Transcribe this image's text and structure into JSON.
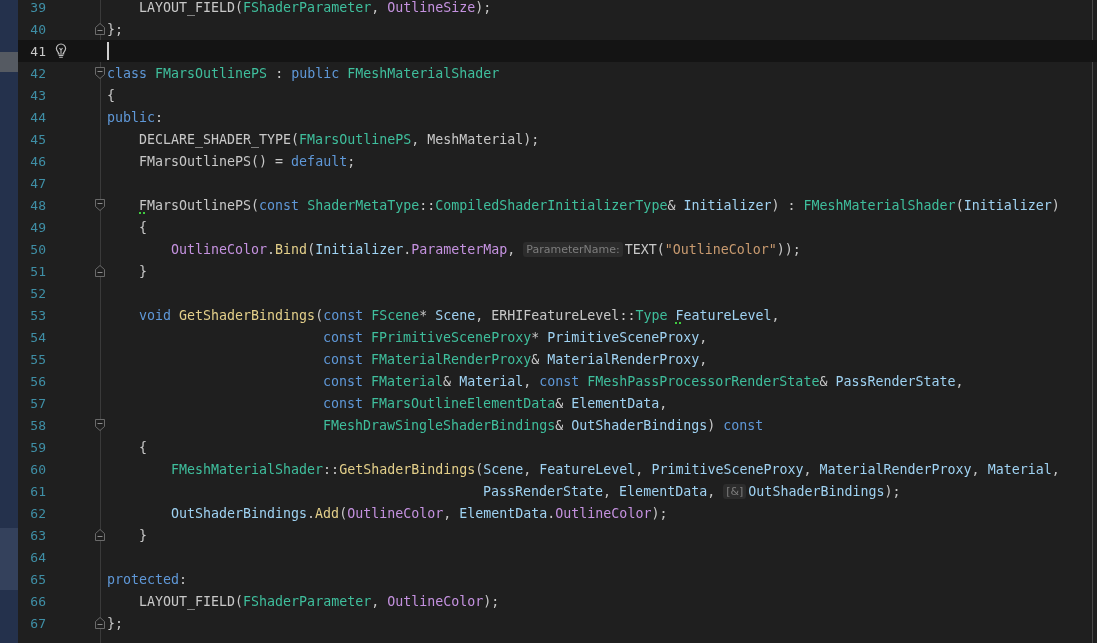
{
  "editor": {
    "lines": [
      {
        "number": "39",
        "current": false,
        "bulb": false,
        "fold_start": false,
        "fold_end": false,
        "tokens": [
          {
            "text": "    LAYOUT_FIELD(",
            "kind": "plain"
          },
          {
            "text": "FShaderParameter",
            "kind": "type"
          },
          {
            "text": ", ",
            "kind": "plain"
          },
          {
            "text": "OutlineSize",
            "kind": "field"
          },
          {
            "text": ");",
            "kind": "plain"
          }
        ]
      },
      {
        "number": "40",
        "current": false,
        "bulb": false,
        "fold_start": false,
        "fold_end": true,
        "tokens": [
          {
            "text": "};",
            "kind": "plain"
          }
        ]
      },
      {
        "number": "41",
        "current": true,
        "bulb": true,
        "fold_start": false,
        "fold_end": false
      },
      {
        "number": "42",
        "current": false,
        "bulb": false,
        "fold_start": true,
        "fold_end": false,
        "tokens": [
          {
            "text": "class ",
            "kind": "keyword"
          },
          {
            "text": "FMarsOutlinePS",
            "kind": "type"
          },
          {
            "text": " : ",
            "kind": "plain"
          },
          {
            "text": "public ",
            "kind": "keyword"
          },
          {
            "text": "FMeshMaterialShader",
            "kind": "type"
          }
        ]
      },
      {
        "number": "43",
        "current": false,
        "bulb": false,
        "fold_start": false,
        "fold_end": false,
        "tokens": [
          {
            "text": "{",
            "kind": "plain"
          }
        ]
      },
      {
        "number": "44",
        "current": false,
        "bulb": false,
        "fold_start": false,
        "fold_end": false,
        "tokens": [
          {
            "text": "public",
            "kind": "keyword"
          },
          {
            "text": ":",
            "kind": "plain"
          }
        ]
      },
      {
        "number": "45",
        "current": false,
        "bulb": false,
        "fold_start": false,
        "fold_end": false,
        "tokens": [
          {
            "text": "    DECLARE_SHADER_TYPE(",
            "kind": "plain"
          },
          {
            "text": "FMarsOutlinePS",
            "kind": "type"
          },
          {
            "text": ", MeshMaterial);",
            "kind": "plain"
          }
        ]
      },
      {
        "number": "46",
        "current": false,
        "bulb": false,
        "fold_start": false,
        "fold_end": false,
        "tokens": [
          {
            "text": "    FMarsOutlinePS() = ",
            "kind": "plain"
          },
          {
            "text": "default",
            "kind": "keyword"
          },
          {
            "text": ";",
            "kind": "plain"
          }
        ]
      },
      {
        "number": "47",
        "current": false,
        "bulb": false,
        "fold_start": false,
        "fold_end": false
      },
      {
        "number": "48",
        "current": false,
        "bulb": false,
        "fold_start": true,
        "fold_end": false,
        "tokens": [
          {
            "text": "    F",
            "kind": "plain",
            "warning": true
          },
          {
            "text": "MarsOutlinePS(",
            "kind": "plain"
          },
          {
            "text": "const ",
            "kind": "keyword"
          },
          {
            "text": "ShaderMetaType",
            "kind": "type"
          },
          {
            "text": "::",
            "kind": "plain"
          },
          {
            "text": "CompiledShaderInitializerType",
            "kind": "type"
          },
          {
            "text": "& ",
            "kind": "plain"
          },
          {
            "text": "Initializer",
            "kind": "variable"
          },
          {
            "text": ") : ",
            "kind": "plain"
          },
          {
            "text": "FMeshMaterialShader",
            "kind": "type"
          },
          {
            "text": "(",
            "kind": "plain"
          },
          {
            "text": "Initializer",
            "kind": "variable"
          },
          {
            "text": ")",
            "kind": "plain"
          }
        ]
      },
      {
        "number": "49",
        "current": false,
        "bulb": false,
        "fold_start": false,
        "fold_end": false,
        "tokens": [
          {
            "text": "    {",
            "kind": "plain"
          }
        ]
      },
      {
        "number": "50",
        "current": false,
        "bulb": false,
        "fold_start": false,
        "fold_end": false,
        "tokens": [
          {
            "text": "        OutlineColor",
            "kind": "field"
          },
          {
            "text": ".",
            "kind": "plain"
          },
          {
            "text": "Bind",
            "kind": "function"
          },
          {
            "text": "(",
            "kind": "plain"
          },
          {
            "text": "Initializer",
            "kind": "variable"
          },
          {
            "text": ".",
            "kind": "plain"
          },
          {
            "text": "ParameterMap",
            "kind": "field"
          },
          {
            "text": ", ",
            "kind": "plain"
          },
          {
            "text": "ParameterName:",
            "kind": "hint"
          },
          {
            "text": "TEXT(",
            "kind": "plain"
          },
          {
            "text": "\"OutlineColor\"",
            "kind": "string"
          },
          {
            "text": "));",
            "kind": "plain"
          }
        ]
      },
      {
        "number": "51",
        "current": false,
        "bulb": false,
        "fold_start": false,
        "fold_end": true,
        "tokens": [
          {
            "text": "    }",
            "kind": "plain"
          }
        ]
      },
      {
        "number": "52",
        "current": false,
        "bulb": false,
        "fold_start": false,
        "fold_end": false
      },
      {
        "number": "53",
        "current": false,
        "bulb": false,
        "fold_start": false,
        "fold_end": false,
        "tokens": [
          {
            "text": "    void ",
            "kind": "keyword"
          },
          {
            "text": "GetShaderBindings",
            "kind": "function"
          },
          {
            "text": "(",
            "kind": "plain"
          },
          {
            "text": "const ",
            "kind": "keyword"
          },
          {
            "text": "FScene",
            "kind": "type"
          },
          {
            "text": "* ",
            "kind": "plain"
          },
          {
            "text": "Scene",
            "kind": "variable"
          },
          {
            "text": ", ERHIFeatureLevel::",
            "kind": "plain"
          },
          {
            "text": "Type ",
            "kind": "type"
          },
          {
            "text": "F",
            "kind": "variable",
            "warning": true
          },
          {
            "text": "eatureLevel",
            "kind": "variable"
          },
          {
            "text": ",",
            "kind": "plain"
          }
        ]
      },
      {
        "number": "54",
        "current": false,
        "bulb": false,
        "fold_start": false,
        "fold_end": false,
        "tokens": [
          {
            "text": "                           const ",
            "kind": "keyword"
          },
          {
            "text": "FPrimitiveSceneProxy",
            "kind": "type"
          },
          {
            "text": "* ",
            "kind": "plain"
          },
          {
            "text": "PrimitiveSceneProxy",
            "kind": "variable"
          },
          {
            "text": ",",
            "kind": "plain"
          }
        ]
      },
      {
        "number": "55",
        "current": false,
        "bulb": false,
        "fold_start": false,
        "fold_end": false,
        "tokens": [
          {
            "text": "                           const ",
            "kind": "keyword"
          },
          {
            "text": "FMaterialRenderProxy",
            "kind": "type"
          },
          {
            "text": "& ",
            "kind": "plain"
          },
          {
            "text": "MaterialRenderProxy",
            "kind": "variable"
          },
          {
            "text": ",",
            "kind": "plain"
          }
        ]
      },
      {
        "number": "56",
        "current": false,
        "bulb": false,
        "fold_start": false,
        "fold_end": false,
        "tokens": [
          {
            "text": "                           const ",
            "kind": "keyword"
          },
          {
            "text": "FMaterial",
            "kind": "type"
          },
          {
            "text": "& ",
            "kind": "plain"
          },
          {
            "text": "Material",
            "kind": "variable"
          },
          {
            "text": ", ",
            "kind": "plain"
          },
          {
            "text": "const ",
            "kind": "keyword"
          },
          {
            "text": "FMeshPassProcessorRenderState",
            "kind": "type"
          },
          {
            "text": "& ",
            "kind": "plain"
          },
          {
            "text": "PassRenderState",
            "kind": "variable"
          },
          {
            "text": ",",
            "kind": "plain"
          }
        ]
      },
      {
        "number": "57",
        "current": false,
        "bulb": false,
        "fold_start": false,
        "fold_end": false,
        "tokens": [
          {
            "text": "                           const ",
            "kind": "keyword"
          },
          {
            "text": "FMarsOutlineElementData",
            "kind": "type"
          },
          {
            "text": "& ",
            "kind": "plain"
          },
          {
            "text": "ElementData",
            "kind": "variable"
          },
          {
            "text": ",",
            "kind": "plain"
          }
        ]
      },
      {
        "number": "58",
        "current": false,
        "bulb": false,
        "fold_start": true,
        "fold_end": false,
        "tokens": [
          {
            "text": "                           FMeshDrawSingleShaderBindings",
            "kind": "type"
          },
          {
            "text": "& ",
            "kind": "plain"
          },
          {
            "text": "OutShaderBindings",
            "kind": "variable"
          },
          {
            "text": ") ",
            "kind": "plain"
          },
          {
            "text": "const",
            "kind": "keyword"
          }
        ]
      },
      {
        "number": "59",
        "current": false,
        "bulb": false,
        "fold_start": false,
        "fold_end": false,
        "tokens": [
          {
            "text": "    {",
            "kind": "plain"
          }
        ]
      },
      {
        "number": "60",
        "current": false,
        "bulb": false,
        "fold_start": false,
        "fold_end": false,
        "tokens": [
          {
            "text": "        FMeshMaterialShader",
            "kind": "type"
          },
          {
            "text": "::",
            "kind": "plain"
          },
          {
            "text": "GetShaderBindings",
            "kind": "function"
          },
          {
            "text": "(",
            "kind": "plain"
          },
          {
            "text": "Scene",
            "kind": "variable"
          },
          {
            "text": ", ",
            "kind": "plain"
          },
          {
            "text": "FeatureLevel",
            "kind": "variable"
          },
          {
            "text": ", ",
            "kind": "plain"
          },
          {
            "text": "PrimitiveSceneProxy",
            "kind": "variable"
          },
          {
            "text": ", ",
            "kind": "plain"
          },
          {
            "text": "MaterialRenderProxy",
            "kind": "variable"
          },
          {
            "text": ", ",
            "kind": "plain"
          },
          {
            "text": "Material",
            "kind": "variable"
          },
          {
            "text": ",",
            "kind": "plain"
          }
        ]
      },
      {
        "number": "61",
        "current": false,
        "bulb": false,
        "fold_start": false,
        "fold_end": false,
        "tokens": [
          {
            "text": "                                               PassRenderState",
            "kind": "variable"
          },
          {
            "text": ", ",
            "kind": "plain"
          },
          {
            "text": "ElementData",
            "kind": "variable"
          },
          {
            "text": ", ",
            "kind": "plain"
          },
          {
            "text": "[&]",
            "kind": "hint"
          },
          {
            "text": "OutShaderBindings",
            "kind": "variable"
          },
          {
            "text": ");",
            "kind": "plain"
          }
        ]
      },
      {
        "number": "62",
        "current": false,
        "bulb": false,
        "fold_start": false,
        "fold_end": false,
        "tokens": [
          {
            "text": "        OutShaderBindings",
            "kind": "variable"
          },
          {
            "text": ".",
            "kind": "plain"
          },
          {
            "text": "Add",
            "kind": "function"
          },
          {
            "text": "(",
            "kind": "plain"
          },
          {
            "text": "OutlineColor",
            "kind": "field"
          },
          {
            "text": ", ",
            "kind": "plain"
          },
          {
            "text": "ElementData",
            "kind": "variable"
          },
          {
            "text": ".",
            "kind": "plain"
          },
          {
            "text": "OutlineColor",
            "kind": "field"
          },
          {
            "text": ");",
            "kind": "plain"
          }
        ]
      },
      {
        "number": "63",
        "current": false,
        "bulb": false,
        "fold_start": false,
        "fold_end": true,
        "tokens": [
          {
            "text": "    }",
            "kind": "plain"
          }
        ]
      },
      {
        "number": "64",
        "current": false,
        "bulb": false,
        "fold_start": false,
        "fold_end": false
      },
      {
        "number": "65",
        "current": false,
        "bulb": false,
        "fold_start": false,
        "fold_end": false,
        "tokens": [
          {
            "text": "protected",
            "kind": "keyword"
          },
          {
            "text": ":",
            "kind": "plain"
          }
        ]
      },
      {
        "number": "66",
        "current": false,
        "bulb": false,
        "fold_start": false,
        "fold_end": false,
        "tokens": [
          {
            "text": "    LAYOUT_FIELD(",
            "kind": "plain"
          },
          {
            "text": "FShaderParameter",
            "kind": "type"
          },
          {
            "text": ", ",
            "kind": "plain"
          },
          {
            "text": "OutlineColor",
            "kind": "field"
          },
          {
            "text": ");",
            "kind": "plain"
          }
        ]
      },
      {
        "number": "67",
        "current": false,
        "bulb": false,
        "fold_start": false,
        "fold_end": true,
        "tokens": [
          {
            "text": "};",
            "kind": "plain"
          }
        ]
      }
    ]
  }
}
